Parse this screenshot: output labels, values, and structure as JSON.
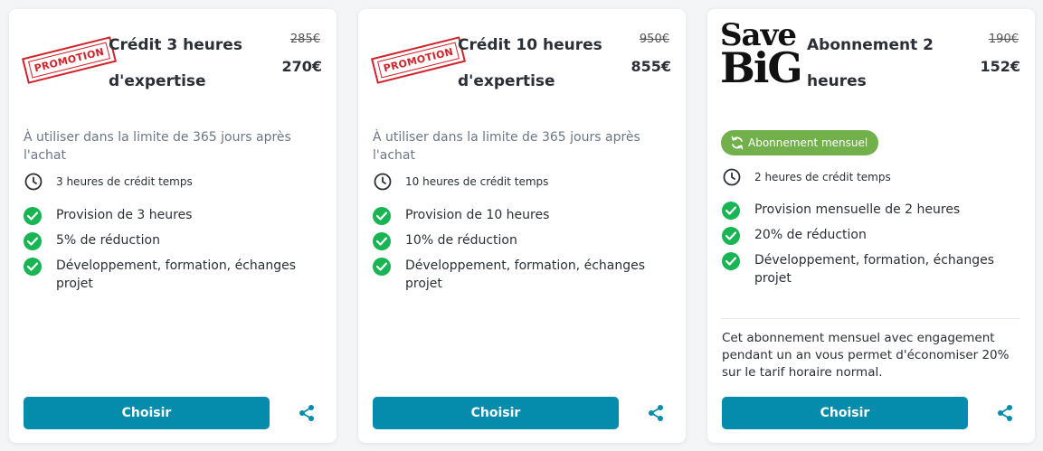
{
  "colors": {
    "accent": "#058cad",
    "check": "#19b454",
    "promo_red": "#d0232b",
    "subscription_green": "#72b04b"
  },
  "cards": [
    {
      "badge": "PROMOTION",
      "title": "Crédit 3 heures d'expertise",
      "old_price": "285€",
      "new_price": "270€",
      "validity": "À utiliser dans la limite de 365 jours après l'achat",
      "credit": "3 heures de crédit temps",
      "features": [
        "Provision de 3 heures",
        "5% de réduction",
        "Développement, formation, échanges projet"
      ],
      "button": "Choisir",
      "share_icon": "share-icon"
    },
    {
      "badge": "PROMOTION",
      "title": "Crédit 10 heures d'expertise",
      "old_price": "950€",
      "new_price": "855€",
      "validity": "À utiliser dans la limite de 365 jours après l'achat",
      "credit": "10 heures de crédit temps",
      "features": [
        "Provision de 10 heures",
        "10% de réduction",
        "Développement, formation, échanges projet"
      ],
      "button": "Choisir",
      "share_icon": "share-icon"
    },
    {
      "badge_line1": "Save",
      "badge_line2": "BiG",
      "title": "Abonnement 2 heures",
      "old_price": "190€",
      "new_price": "152€",
      "tag": "Abonnement mensuel",
      "credit": "2 heures de crédit temps",
      "features": [
        "Provision mensuelle de 2 heures",
        "20% de réduction",
        "Développement, formation, échanges projet"
      ],
      "note": "Cet abonnement mensuel avec engagement pendant un an vous permet d'économiser 20% sur le tarif horaire normal.",
      "button": "Choisir",
      "share_icon": "share-icon"
    }
  ]
}
